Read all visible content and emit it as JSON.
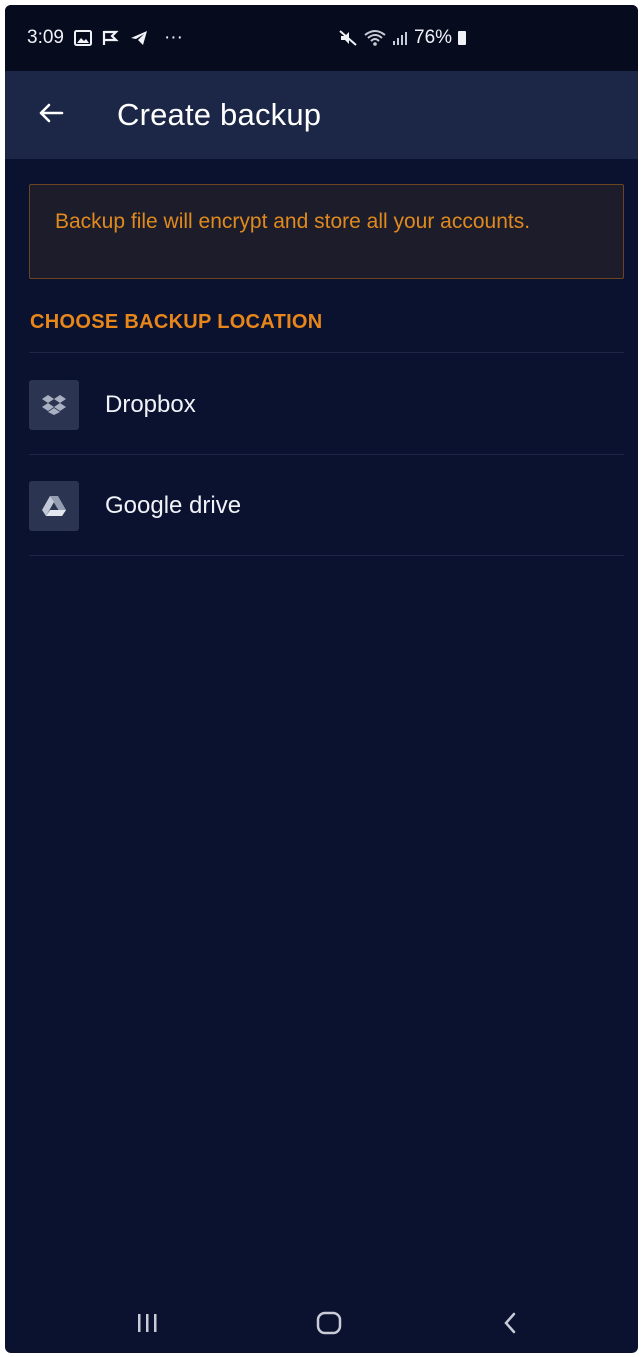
{
  "status_bar": {
    "time": "3:09",
    "overflow_dots": "···",
    "battery_percent": "76%"
  },
  "app_bar": {
    "title": "Create backup"
  },
  "notice": {
    "text": "Backup file will encrypt and store all your accounts."
  },
  "section": {
    "label": "CHOOSE BACKUP LOCATION"
  },
  "options": [
    {
      "label": "Dropbox",
      "icon": "dropbox-icon"
    },
    {
      "label": "Google drive",
      "icon": "google-drive-icon"
    }
  ],
  "colors": {
    "background": "#0a1230",
    "app_bar": "#1c2747",
    "accent_orange": "#e8861a"
  }
}
